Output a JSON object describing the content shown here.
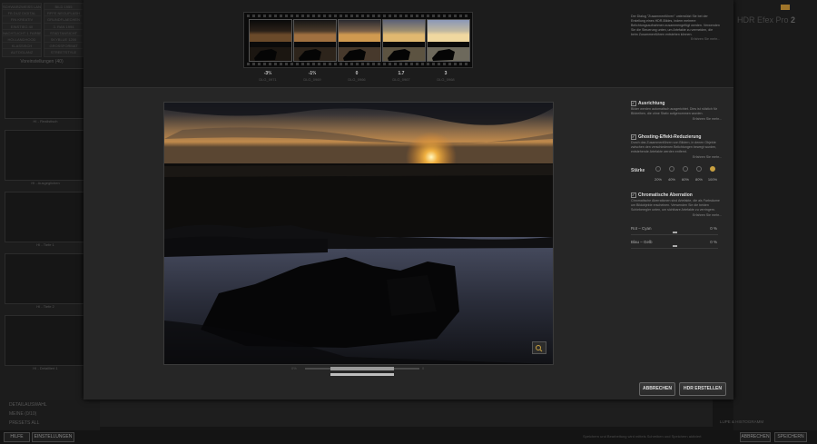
{
  "background": {
    "left_tags": [
      "SCHWARZWEISS LANDSCH",
      "BILD 1955",
      "FB DUZ DIGITAL",
      "RFFE NEOUFLASH",
      "FIN KREATIV",
      "GRUNDFLAECHEN",
      "EINSTIEG 40",
      "3. RAN 1994",
      "NACHTLICHT 1 FARBEN",
      "STADTANSICHT",
      "HOLLANDHOOD",
      "SKYBLUE 1200",
      "KLASSISCH",
      "GROSSFORMAT",
      "AUTOGLANZ",
      "STREETSTYLE"
    ],
    "presets_header": "Voreinstellungen (40)",
    "presets": [
      "HI - Realistisch",
      "HI - Ausgeglichen",
      "HI - Tiefe 1",
      "HI - Tiefe 2",
      "HI - Detailliert 1"
    ],
    "bottom_left": [
      "DETAILAUSWAHL",
      "MEINE (0/10)",
      "PRESETS ALL"
    ],
    "product": "HDR Efex Pro",
    "product_version": "2",
    "status_buttons": {
      "help": "HILFE",
      "settings": "EINSTELLUNGEN",
      "cancel": "ABBRECHEN",
      "save": "SPEICHERN"
    },
    "status_message": "Speichern und Bearbeitung wird mittels Schreiben und Speichern aktiviert",
    "lupe_label": "LUPE & HISTOGRAMM"
  },
  "accent": "#c8a040",
  "dialog": {
    "thumbnails": [
      {
        "ev": "-3⅔",
        "file": "DLG_0971"
      },
      {
        "ev": "-1⅔",
        "file": "DLG_0969"
      },
      {
        "ev": "0",
        "file": "DLG_0966"
      },
      {
        "ev": "1.7",
        "file": "DLG_0967"
      },
      {
        "ev": "3",
        "file": "DLG_0968"
      }
    ],
    "info": {
      "text": "Der Dialog \"Zusammenführen\" unterstützt Sie bei der Erstellung eines HDR-Bildes, indem mehrere Belichtungsaufnahmen zusammengefügt werden. Verwenden Sie die Steuerung unten, um Artefakte zu vermeiden, die beim Zusammenführen entstehen können.",
      "more": "Erfahren Sie mehr..."
    },
    "alignment": {
      "title": "Ausrichtung",
      "desc": "Bilder werden automatisch ausgerichtet. Dies ist nützlich für Bildreihen, die ohne Stativ aufgenommen wurden.",
      "more": "Erfahren Sie mehr..."
    },
    "ghosting": {
      "title": "Ghosting-Effekt-Reduzierung",
      "desc": "Durch das Zusammenführen von Bildern, in denen Objekte zwischen den verschiedenen Belichtungen bewegt wurden, entstehende Artefakte werden entfernt.",
      "more": "Erfahren Sie mehr...",
      "strength_label": "Stärke",
      "strength_options": [
        "20%",
        "40%",
        "60%",
        "80%",
        "100%"
      ],
      "strength_selected": 4
    },
    "chromatic": {
      "title": "Chromatische Aberration",
      "desc": "Chromatische Aberrationen sind Artefakte, die als Farbsäume um Bildobjekte erscheinen. Verwenden Sie die beiden Schieberegler unten, um sichtbare Artefakte zu verringern.",
      "more": "Erfahren Sie mehr...",
      "red_cyan_label": "Rot – Cyan",
      "red_cyan_value": "0 %",
      "blue_yellow_label": "Blau – Gelb",
      "blue_yellow_value": "0 %"
    },
    "zoom": {
      "min": "0%",
      "max": "0"
    },
    "buttons": {
      "cancel": "ABBRECHEN",
      "create": "HDR ERSTELLEN"
    }
  }
}
